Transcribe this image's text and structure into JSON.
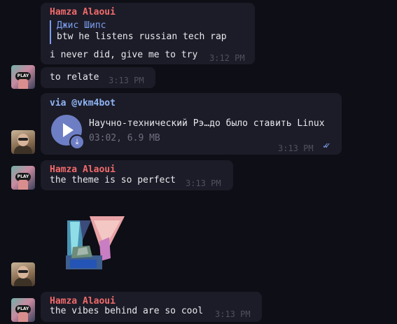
{
  "messages": {
    "m1": {
      "sender": "Hamza Alaoui",
      "reply_author": "Джис Шипс",
      "reply_text": "btw he listens russian tech rap",
      "text": "i never did, give me to try",
      "time": "3:12 PM"
    },
    "m2": {
      "text": "to relate",
      "time": "3:13 PM"
    },
    "m3": {
      "via": "via @vkm4bot",
      "track_title": "Научно-технический Рэ…до было ставить Linux",
      "track_meta": "03:02, 6.9 MB",
      "time": "3:13 PM",
      "read_icon": "double-check-icon"
    },
    "m4": {
      "sender": "Hamza Alaoui",
      "text": "the theme is so perfect",
      "time": "3:13 PM"
    },
    "m5": {
      "sticker": "pixel-art-sticker"
    },
    "m6": {
      "sender": "Hamza Alaoui",
      "text": "the vibes behind are so cool",
      "time": "3:13 PM"
    }
  },
  "avatars": {
    "hamza_label": "PLAY"
  },
  "colors": {
    "background": "#0e0e16",
    "bubble": "#1c1c28",
    "sender_name": "#f06a6a",
    "accent": "#7b9ef0",
    "timestamp": "#50505e"
  }
}
